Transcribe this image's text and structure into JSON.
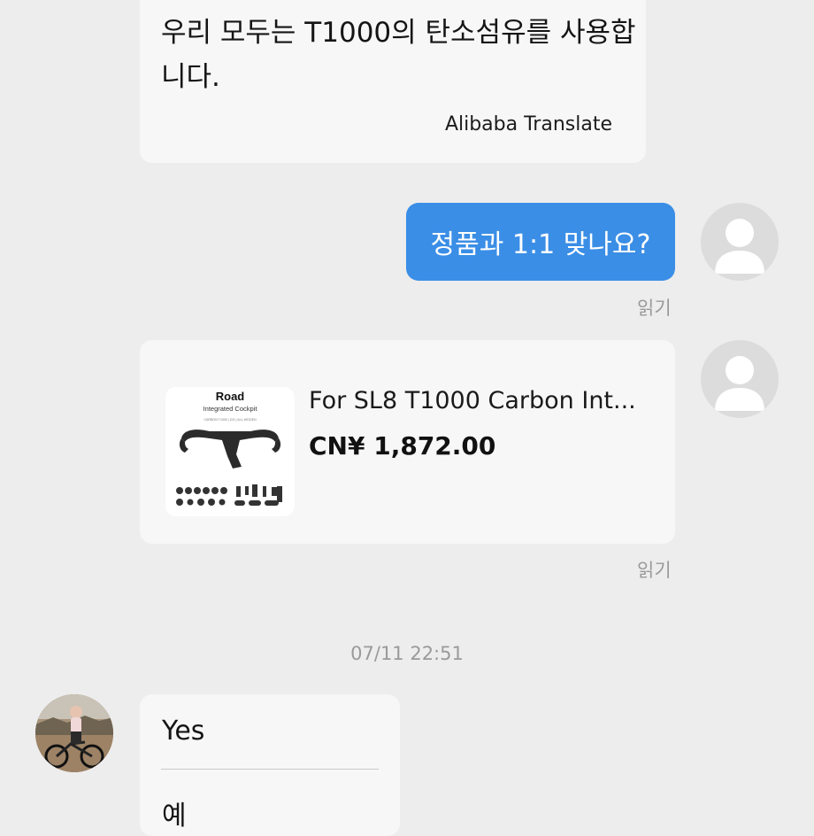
{
  "messages": {
    "translated": {
      "text": "우리 모두는 T1000의 탄소섬유를 사용합니다.",
      "source": "Alibaba Translate"
    },
    "outgoing": {
      "text": "정품과 1:1 맞나요?",
      "status": "읽기"
    },
    "product_card": {
      "image_title": "Road",
      "image_subtitle": "Integrated Cockpit",
      "image_caption": "CARBON T1000 | DI2 | ALL-HIDDEN",
      "title": "For SL8 T1000 Carbon Int...",
      "price": "CN¥ 1,872.00",
      "status": "읽기"
    },
    "timestamp": "07/11 22:51",
    "reply": {
      "text": "Yes",
      "translation": "예"
    }
  },
  "colors": {
    "background": "#ededed",
    "outgoing_bubble": "#3a8ee6",
    "incoming_bubble": "#f7f7f7"
  }
}
